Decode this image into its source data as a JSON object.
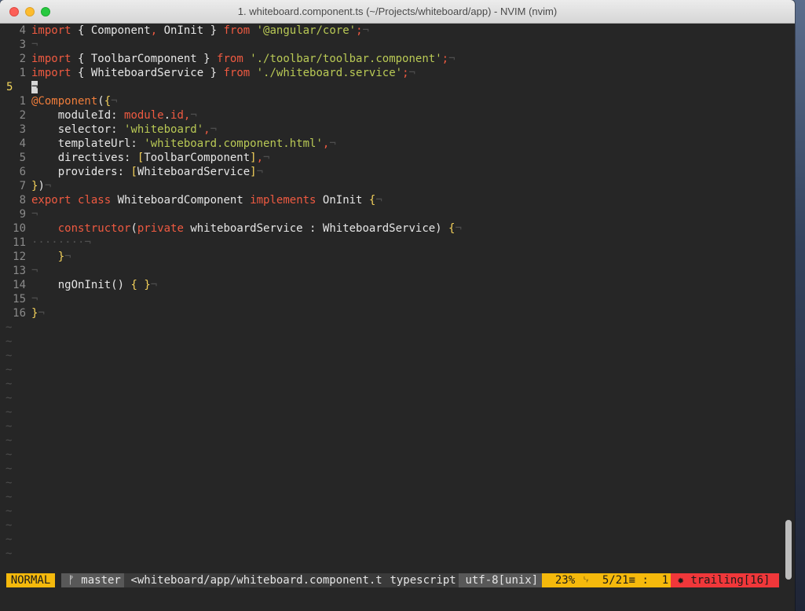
{
  "window": {
    "title": "1. whiteboard.component.ts (~/Projects/whiteboard/app) - NVIM (nvim)"
  },
  "editor": {
    "eol_glyph": "¬",
    "tilde": "~",
    "lines": [
      {
        "num": "4",
        "tokens": [
          [
            "kw2",
            "import"
          ],
          [
            "ident",
            " { "
          ],
          [
            "ident",
            "Component"
          ],
          [
            "kw2",
            ", "
          ],
          [
            "ident",
            "OnInit"
          ],
          [
            "ident",
            " } "
          ],
          [
            "kw2",
            "from"
          ],
          [
            "ident",
            " "
          ],
          [
            "str",
            "'@angular/core'"
          ],
          [
            "kw2",
            ";"
          ],
          [
            "eol",
            "¬"
          ]
        ]
      },
      {
        "num": "3",
        "tokens": [
          [
            "eol",
            "¬"
          ]
        ]
      },
      {
        "num": "2",
        "tokens": [
          [
            "kw2",
            "import"
          ],
          [
            "ident",
            " { "
          ],
          [
            "ident",
            "ToolbarComponent"
          ],
          [
            "ident",
            " } "
          ],
          [
            "kw2",
            "from"
          ],
          [
            "ident",
            " "
          ],
          [
            "str",
            "'./toolbar/toolbar.component'"
          ],
          [
            "kw2",
            ";"
          ],
          [
            "eol",
            "¬"
          ]
        ]
      },
      {
        "num": "1",
        "tokens": [
          [
            "kw2",
            "import"
          ],
          [
            "ident",
            " { "
          ],
          [
            "ident",
            "WhiteboardService"
          ],
          [
            "ident",
            " } "
          ],
          [
            "kw2",
            "from"
          ],
          [
            "ident",
            " "
          ],
          [
            "str",
            "'./whiteboard.service'"
          ],
          [
            "kw2",
            ";"
          ],
          [
            "eol",
            "¬"
          ]
        ]
      },
      {
        "num": "5",
        "current": true,
        "tokens": [
          [
            "cursor",
            "¬"
          ]
        ]
      },
      {
        "num": "1",
        "tokens": [
          [
            "dec",
            "@Component"
          ],
          [
            "ident",
            "("
          ],
          [
            "br",
            "{"
          ],
          [
            "eol",
            "¬"
          ]
        ]
      },
      {
        "num": "2",
        "tokens": [
          [
            "ident",
            "    moduleId: "
          ],
          [
            "kw2",
            "module"
          ],
          [
            "ident",
            "."
          ],
          [
            "kw2",
            "id"
          ],
          [
            "kw2",
            ","
          ],
          [
            "eol",
            "¬"
          ]
        ]
      },
      {
        "num": "3",
        "tokens": [
          [
            "ident",
            "    selector: "
          ],
          [
            "str",
            "'whiteboard'"
          ],
          [
            "kw2",
            ","
          ],
          [
            "eol",
            "¬"
          ]
        ]
      },
      {
        "num": "4",
        "tokens": [
          [
            "ident",
            "    templateUrl: "
          ],
          [
            "str",
            "'whiteboard.component.html'"
          ],
          [
            "kw2",
            ","
          ],
          [
            "eol",
            "¬"
          ]
        ]
      },
      {
        "num": "5",
        "tokens": [
          [
            "ident",
            "    directives: "
          ],
          [
            "br",
            "["
          ],
          [
            "ident",
            "ToolbarComponent"
          ],
          [
            "br",
            "]"
          ],
          [
            "kw2",
            ","
          ],
          [
            "eol",
            "¬"
          ]
        ]
      },
      {
        "num": "6",
        "tokens": [
          [
            "ident",
            "    providers: "
          ],
          [
            "br",
            "["
          ],
          [
            "ident",
            "WhiteboardService"
          ],
          [
            "br",
            "]"
          ],
          [
            "eol",
            "¬"
          ]
        ]
      },
      {
        "num": "7",
        "tokens": [
          [
            "br",
            "}"
          ],
          [
            "ident",
            ")"
          ],
          [
            "eol",
            "¬"
          ]
        ]
      },
      {
        "num": "8",
        "tokens": [
          [
            "kw2",
            "export"
          ],
          [
            "ident",
            " "
          ],
          [
            "kw2",
            "class"
          ],
          [
            "ident",
            " WhiteboardComponent "
          ],
          [
            "kw2",
            "implements"
          ],
          [
            "ident",
            " OnInit "
          ],
          [
            "br",
            "{"
          ],
          [
            "eol",
            "¬"
          ]
        ]
      },
      {
        "num": "9",
        "tokens": [
          [
            "eol",
            "¬"
          ]
        ]
      },
      {
        "num": "10",
        "tokens": [
          [
            "ident",
            "    "
          ],
          [
            "kw2",
            "constructor"
          ],
          [
            "ident",
            "("
          ],
          [
            "kw2",
            "private"
          ],
          [
            "ident",
            " whiteboardService : WhiteboardService) "
          ],
          [
            "br",
            "{"
          ],
          [
            "eol",
            "¬"
          ]
        ]
      },
      {
        "num": "11",
        "tokens": [
          [
            "dots",
            "········"
          ],
          [
            "eol",
            "¬"
          ]
        ]
      },
      {
        "num": "12",
        "tokens": [
          [
            "ident",
            "    "
          ],
          [
            "br",
            "}"
          ],
          [
            "eol",
            "¬"
          ]
        ]
      },
      {
        "num": "13",
        "tokens": [
          [
            "eol",
            "¬"
          ]
        ]
      },
      {
        "num": "14",
        "tokens": [
          [
            "ident",
            "    ngOnInit() "
          ],
          [
            "br",
            "{"
          ],
          [
            "ident",
            " "
          ],
          [
            "br",
            "}"
          ],
          [
            "eol",
            "¬"
          ]
        ]
      },
      {
        "num": "15",
        "tokens": [
          [
            "eol",
            "¬"
          ]
        ]
      },
      {
        "num": "16",
        "tokens": [
          [
            "br",
            "}"
          ],
          [
            "eol",
            "¬"
          ]
        ]
      }
    ]
  },
  "statusline": {
    "mode": "NORMAL",
    "branch_icon": "ᚠ",
    "branch": "master",
    "file": "<whiteboard/app/whiteboard.component.ts",
    "filetype": "typescript",
    "encoding": "utf-8[unix]",
    "percent": "23%",
    "percent_icon": "␊",
    "position": "5/21",
    "position_icon": "≡",
    "column": "1",
    "warning_icon": "✹",
    "warning": "trailing[16]"
  }
}
